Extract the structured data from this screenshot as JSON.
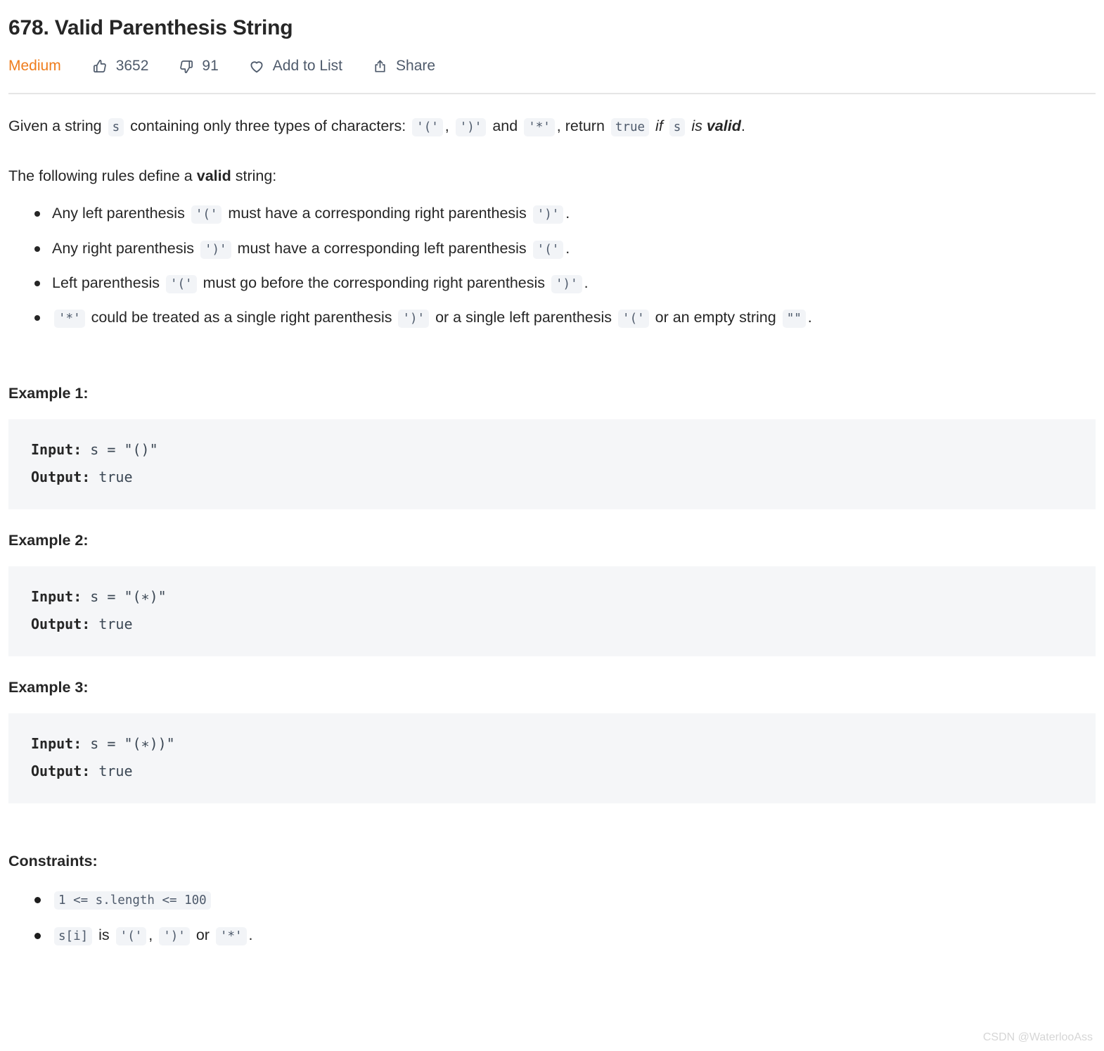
{
  "problem": {
    "title": "678. Valid Parenthesis String",
    "difficulty": "Medium",
    "likes": "3652",
    "dislikes": "91",
    "add_to_list": "Add to List",
    "share": "Share",
    "icons": {
      "like": "thumbs-up-icon",
      "dislike": "thumbs-down-icon",
      "favorite": "heart-icon",
      "share": "share-icon"
    }
  },
  "description": {
    "intro": {
      "p1": "Given a string",
      "code_s": "s",
      "p2": "containing only three types of characters:",
      "code_lparen": "'('",
      "comma": ",",
      "code_rparen": "')'",
      "p3": "and",
      "code_star": "'*'",
      "p4": ", return",
      "code_true": "true",
      "p5": "if",
      "code_s2": "s",
      "p6": "is",
      "bold_valid": "valid",
      "period": "."
    },
    "rules_intro": {
      "p1": "The following rules define a",
      "bold": "valid",
      "p2": "string:"
    },
    "rules": [
      {
        "t1": "Any left parenthesis",
        "c1": "'('",
        "t2": "must have a corresponding right parenthesis",
        "c2": "')'",
        "t3": "."
      },
      {
        "t1": "Any right parenthesis",
        "c1": "')'",
        "t2": "must have a corresponding left parenthesis",
        "c2": "'('",
        "t3": "."
      },
      {
        "t1": "Left parenthesis",
        "c1": "'('",
        "t2": "must go before the corresponding right parenthesis",
        "c2": "')'",
        "t3": "."
      }
    ],
    "star_rule": {
      "c0": "'*'",
      "t1": "could be treated as a single right parenthesis",
      "c1": "')'",
      "t2": "or a single left parenthesis",
      "c2": "'('",
      "t3": "or an empty string",
      "c3": "\"\"",
      "t4": "."
    }
  },
  "examples": [
    {
      "heading": "Example 1:",
      "input_label": "Input:",
      "input_value": " s = \"()\"",
      "output_label": "Output:",
      "output_value": " true"
    },
    {
      "heading": "Example 2:",
      "input_label": "Input:",
      "input_value": " s = \"(∗)\"",
      "output_label": "Output:",
      "output_value": " true"
    },
    {
      "heading": "Example 3:",
      "input_label": "Input:",
      "input_value": " s = \"(∗))\"",
      "output_label": "Output:",
      "output_value": " true"
    }
  ],
  "constraints": {
    "heading": "Constraints:",
    "items": [
      {
        "c1": "1 <= s.length <= 100"
      },
      {
        "c1": "s[i]",
        "t1": "is",
        "c2": "'('",
        "t2": ",",
        "c3": "')'",
        "t3": "or",
        "c4": "'*'",
        "t4": "."
      }
    ]
  },
  "watermark": "CSDN @WaterlooAss",
  "colors": {
    "difficulty": "#ef7c1c",
    "code_chip_bg": "#f2f4f7",
    "code_chip_fg": "#4e5a6b",
    "example_bg": "#f5f6f8",
    "text": "#262626"
  }
}
